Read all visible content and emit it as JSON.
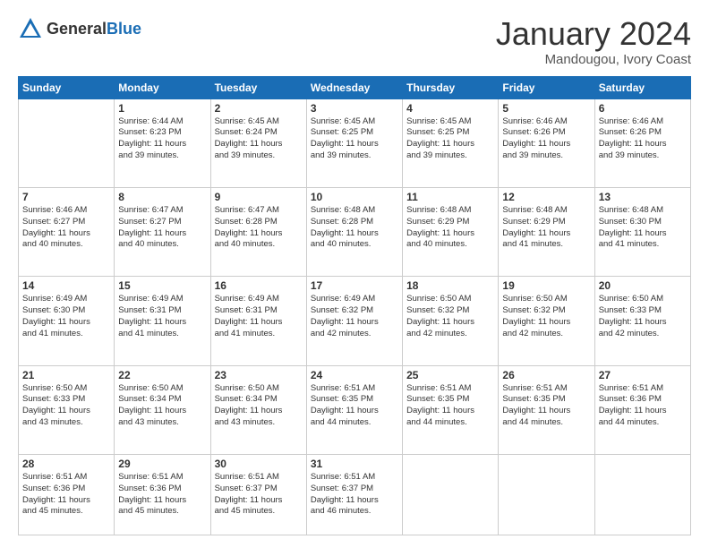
{
  "header": {
    "logo": {
      "general": "General",
      "blue": "Blue"
    },
    "title": "January 2024",
    "location": "Mandougou, Ivory Coast"
  },
  "calendar": {
    "days_of_week": [
      "Sunday",
      "Monday",
      "Tuesday",
      "Wednesday",
      "Thursday",
      "Friday",
      "Saturday"
    ],
    "weeks": [
      [
        {
          "day": "",
          "info": ""
        },
        {
          "day": "1",
          "info": "Sunrise: 6:44 AM\nSunset: 6:23 PM\nDaylight: 11 hours\nand 39 minutes."
        },
        {
          "day": "2",
          "info": "Sunrise: 6:45 AM\nSunset: 6:24 PM\nDaylight: 11 hours\nand 39 minutes."
        },
        {
          "day": "3",
          "info": "Sunrise: 6:45 AM\nSunset: 6:25 PM\nDaylight: 11 hours\nand 39 minutes."
        },
        {
          "day": "4",
          "info": "Sunrise: 6:45 AM\nSunset: 6:25 PM\nDaylight: 11 hours\nand 39 minutes."
        },
        {
          "day": "5",
          "info": "Sunrise: 6:46 AM\nSunset: 6:26 PM\nDaylight: 11 hours\nand 39 minutes."
        },
        {
          "day": "6",
          "info": "Sunrise: 6:46 AM\nSunset: 6:26 PM\nDaylight: 11 hours\nand 39 minutes."
        }
      ],
      [
        {
          "day": "7",
          "info": "Sunrise: 6:46 AM\nSunset: 6:27 PM\nDaylight: 11 hours\nand 40 minutes."
        },
        {
          "day": "8",
          "info": "Sunrise: 6:47 AM\nSunset: 6:27 PM\nDaylight: 11 hours\nand 40 minutes."
        },
        {
          "day": "9",
          "info": "Sunrise: 6:47 AM\nSunset: 6:28 PM\nDaylight: 11 hours\nand 40 minutes."
        },
        {
          "day": "10",
          "info": "Sunrise: 6:48 AM\nSunset: 6:28 PM\nDaylight: 11 hours\nand 40 minutes."
        },
        {
          "day": "11",
          "info": "Sunrise: 6:48 AM\nSunset: 6:29 PM\nDaylight: 11 hours\nand 40 minutes."
        },
        {
          "day": "12",
          "info": "Sunrise: 6:48 AM\nSunset: 6:29 PM\nDaylight: 11 hours\nand 41 minutes."
        },
        {
          "day": "13",
          "info": "Sunrise: 6:48 AM\nSunset: 6:30 PM\nDaylight: 11 hours\nand 41 minutes."
        }
      ],
      [
        {
          "day": "14",
          "info": "Sunrise: 6:49 AM\nSunset: 6:30 PM\nDaylight: 11 hours\nand 41 minutes."
        },
        {
          "day": "15",
          "info": "Sunrise: 6:49 AM\nSunset: 6:31 PM\nDaylight: 11 hours\nand 41 minutes."
        },
        {
          "day": "16",
          "info": "Sunrise: 6:49 AM\nSunset: 6:31 PM\nDaylight: 11 hours\nand 41 minutes."
        },
        {
          "day": "17",
          "info": "Sunrise: 6:49 AM\nSunset: 6:32 PM\nDaylight: 11 hours\nand 42 minutes."
        },
        {
          "day": "18",
          "info": "Sunrise: 6:50 AM\nSunset: 6:32 PM\nDaylight: 11 hours\nand 42 minutes."
        },
        {
          "day": "19",
          "info": "Sunrise: 6:50 AM\nSunset: 6:32 PM\nDaylight: 11 hours\nand 42 minutes."
        },
        {
          "day": "20",
          "info": "Sunrise: 6:50 AM\nSunset: 6:33 PM\nDaylight: 11 hours\nand 42 minutes."
        }
      ],
      [
        {
          "day": "21",
          "info": "Sunrise: 6:50 AM\nSunset: 6:33 PM\nDaylight: 11 hours\nand 43 minutes."
        },
        {
          "day": "22",
          "info": "Sunrise: 6:50 AM\nSunset: 6:34 PM\nDaylight: 11 hours\nand 43 minutes."
        },
        {
          "day": "23",
          "info": "Sunrise: 6:50 AM\nSunset: 6:34 PM\nDaylight: 11 hours\nand 43 minutes."
        },
        {
          "day": "24",
          "info": "Sunrise: 6:51 AM\nSunset: 6:35 PM\nDaylight: 11 hours\nand 44 minutes."
        },
        {
          "day": "25",
          "info": "Sunrise: 6:51 AM\nSunset: 6:35 PM\nDaylight: 11 hours\nand 44 minutes."
        },
        {
          "day": "26",
          "info": "Sunrise: 6:51 AM\nSunset: 6:35 PM\nDaylight: 11 hours\nand 44 minutes."
        },
        {
          "day": "27",
          "info": "Sunrise: 6:51 AM\nSunset: 6:36 PM\nDaylight: 11 hours\nand 44 minutes."
        }
      ],
      [
        {
          "day": "28",
          "info": "Sunrise: 6:51 AM\nSunset: 6:36 PM\nDaylight: 11 hours\nand 45 minutes."
        },
        {
          "day": "29",
          "info": "Sunrise: 6:51 AM\nSunset: 6:36 PM\nDaylight: 11 hours\nand 45 minutes."
        },
        {
          "day": "30",
          "info": "Sunrise: 6:51 AM\nSunset: 6:37 PM\nDaylight: 11 hours\nand 45 minutes."
        },
        {
          "day": "31",
          "info": "Sunrise: 6:51 AM\nSunset: 6:37 PM\nDaylight: 11 hours\nand 46 minutes."
        },
        {
          "day": "",
          "info": ""
        },
        {
          "day": "",
          "info": ""
        },
        {
          "day": "",
          "info": ""
        }
      ]
    ]
  }
}
